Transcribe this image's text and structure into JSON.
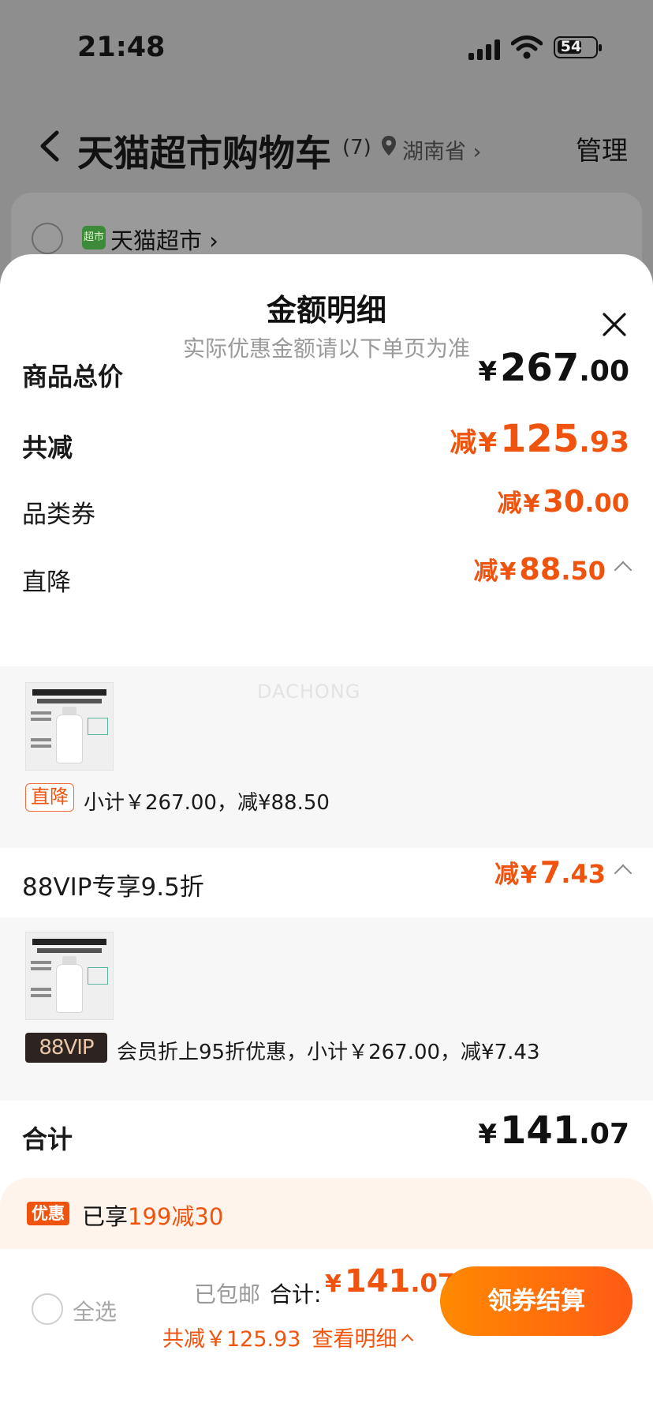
{
  "status_bar": {
    "time": "21:48",
    "battery": "54"
  },
  "nav": {
    "title": "天猫超市购物车",
    "count": "(7)",
    "location": "湖南省",
    "manage": "管理"
  },
  "store": {
    "logo": "超市",
    "name": "天猫超市"
  },
  "sheet": {
    "title": "金额明细",
    "subtitle": "实际优惠金额请以下单页为准",
    "watermark": "DACHONG"
  },
  "rows": {
    "total_price": {
      "label": "商品总价",
      "yen": "¥",
      "int": "267",
      "dec": ".00"
    },
    "total_discount": {
      "label": "共减",
      "prefix": "减",
      "yen": "¥",
      "int": "125",
      "dec": ".93"
    },
    "category_coupon": {
      "label": "品类券",
      "prefix": "减",
      "yen": "¥",
      "int": "30",
      "dec": ".00"
    },
    "direct_drop": {
      "label": "直降",
      "prefix": "减",
      "yen": "¥",
      "int": "88",
      "dec": ".50"
    },
    "vip": {
      "label": "88VIP专享9.5折",
      "prefix": "减",
      "yen": "¥",
      "int": "7",
      "dec": ".43"
    },
    "subtotal": {
      "label": "合计",
      "yen": "¥",
      "int": "141",
      "dec": ".07"
    }
  },
  "direct_drop_detail": {
    "tag": "直降",
    "text": "小计￥267.00，减¥88.50"
  },
  "vip_detail": {
    "tag": "88VIP",
    "text": "会员折上95折优惠，小计￥267.00，减¥7.43"
  },
  "promo": {
    "badge": "优惠",
    "prefix": "已享",
    "highlight": "199减30"
  },
  "checkout": {
    "select_all": "全选",
    "shipping": "已包邮",
    "total_label": "合计:",
    "yen": "¥",
    "int": "141",
    "dec": ".07",
    "saved": "共减￥125.93",
    "view_detail": "查看明细",
    "button": "领券结算"
  },
  "colors": {
    "accent": "#f0530e",
    "button_start": "#ff8a00",
    "button_end": "#ff5a14",
    "vip_tag_bg": "#2d2320"
  }
}
